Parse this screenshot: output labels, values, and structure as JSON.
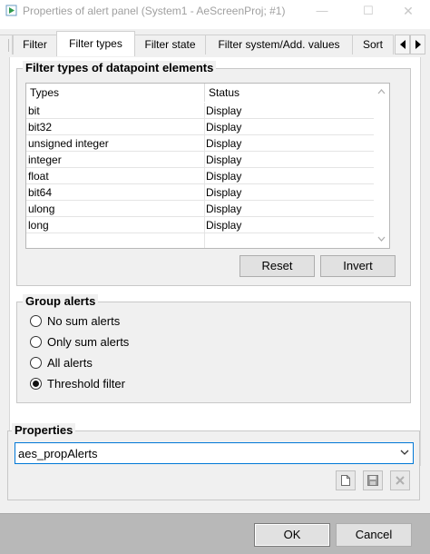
{
  "window": {
    "title": "Properties of alert panel (System1 - AeScreenProj; #1)",
    "controls": {
      "minimize": "—",
      "maximize": "☐",
      "close": "✕"
    }
  },
  "tabs": [
    {
      "label": "Filter",
      "active": false
    },
    {
      "label": "Filter types",
      "active": true
    },
    {
      "label": "Filter state",
      "active": false
    },
    {
      "label": "Filter system/Add. values",
      "active": false
    },
    {
      "label": "Sort",
      "active": false
    }
  ],
  "filter_types": {
    "group_label": "Filter types of datapoint elements",
    "columns": [
      "Types",
      "Status"
    ],
    "rows": [
      {
        "type": "bit",
        "status": "Display"
      },
      {
        "type": "bit32",
        "status": "Display"
      },
      {
        "type": "unsigned integer",
        "status": "Display"
      },
      {
        "type": "integer",
        "status": "Display"
      },
      {
        "type": "float",
        "status": "Display"
      },
      {
        "type": "bit64",
        "status": "Display"
      },
      {
        "type": "ulong",
        "status": "Display"
      },
      {
        "type": "long",
        "status": "Display"
      }
    ],
    "reset_label": "Reset",
    "invert_label": "Invert"
  },
  "group_alerts": {
    "group_label": "Group alerts",
    "options": [
      {
        "label": "No sum alerts",
        "checked": false
      },
      {
        "label": "Only sum alerts",
        "checked": false
      },
      {
        "label": "All alerts",
        "checked": false
      },
      {
        "label": "Threshold filter",
        "checked": true
      }
    ]
  },
  "properties": {
    "group_label": "Properties",
    "selected_value": "aes_propAlerts",
    "icons": [
      "new-document-icon",
      "save-icon",
      "delete-icon"
    ]
  },
  "footer": {
    "ok_label": "OK",
    "cancel_label": "Cancel"
  }
}
